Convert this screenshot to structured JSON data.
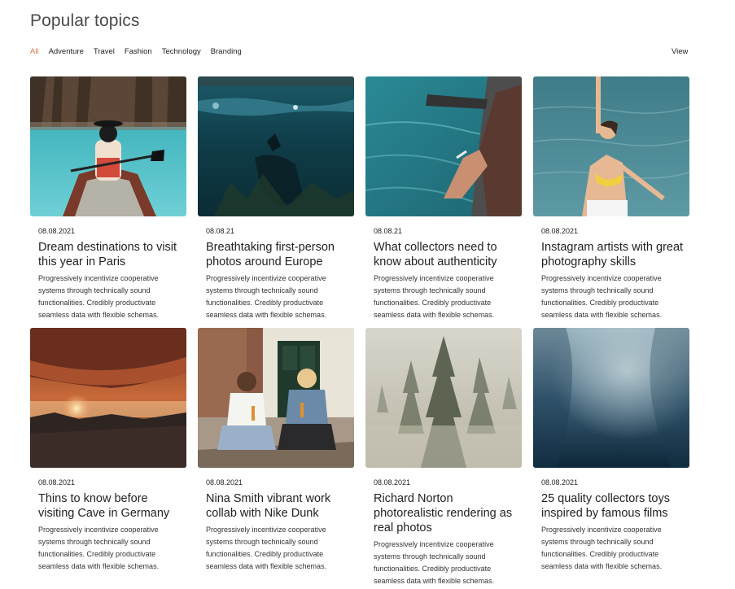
{
  "section_title": "Popular topics",
  "filters": [
    {
      "label": "All",
      "active": true
    },
    {
      "label": "Adventure",
      "active": false
    },
    {
      "label": "Travel",
      "active": false
    },
    {
      "label": "Fashion",
      "active": false
    },
    {
      "label": "Technology",
      "active": false
    },
    {
      "label": "Branding",
      "active": false
    }
  ],
  "view_label": "View",
  "accent_color": "#e07a4a",
  "cards": [
    {
      "date": "08.08.2021",
      "title": "Dream destinations to visit this year in Paris",
      "description": "Progressively incentivize cooperative systems through technically sound functionalities. Credibly productivate seamless data with flexible schemas."
    },
    {
      "date": "08.08.21",
      "title": "Breathtaking first-person photos around Europe",
      "description": "Progressively incentivize cooperative systems through technically sound functionalities. Credibly productivate seamless data with flexible schemas."
    },
    {
      "date": "08.08.21",
      "title": "What collectors need to know about authenticity",
      "description": "Progressively incentivize cooperative systems through technically sound functionalities. Credibly productivate seamless data with flexible schemas."
    },
    {
      "date": "08.08.2021",
      "title": "Instagram artists with great photography skills",
      "description": "Progressively incentivize cooperative systems through technically sound functionalities. Credibly productivate seamless data with flexible schemas."
    },
    {
      "date": "08.08.2021",
      "title": "Thins to know before visiting Cave in Germany",
      "description": "Progressively incentivize cooperative systems through technically sound functionalities. Credibly productivate seamless data with flexible schemas."
    },
    {
      "date": "08.08.2021",
      "title": "Nina Smith vibrant work collab with Nike Dunk",
      "description": "Progressively incentivize cooperative systems through technically sound functionalities. Credibly productivate seamless data with flexible schemas."
    },
    {
      "date": "08.08.2021",
      "title": "Richard Norton photorealistic rendering as real photos",
      "description": "Progressively incentivize cooperative systems through technically sound functionalities. Credibly productivate seamless data with flexible schemas."
    },
    {
      "date": "08.08.2021",
      "title": "25 quality collectors toys inspired by famous films",
      "description": "Progressively incentivize cooperative systems through technically sound functionalities. Credibly productivate seamless data with flexible schemas."
    }
  ]
}
